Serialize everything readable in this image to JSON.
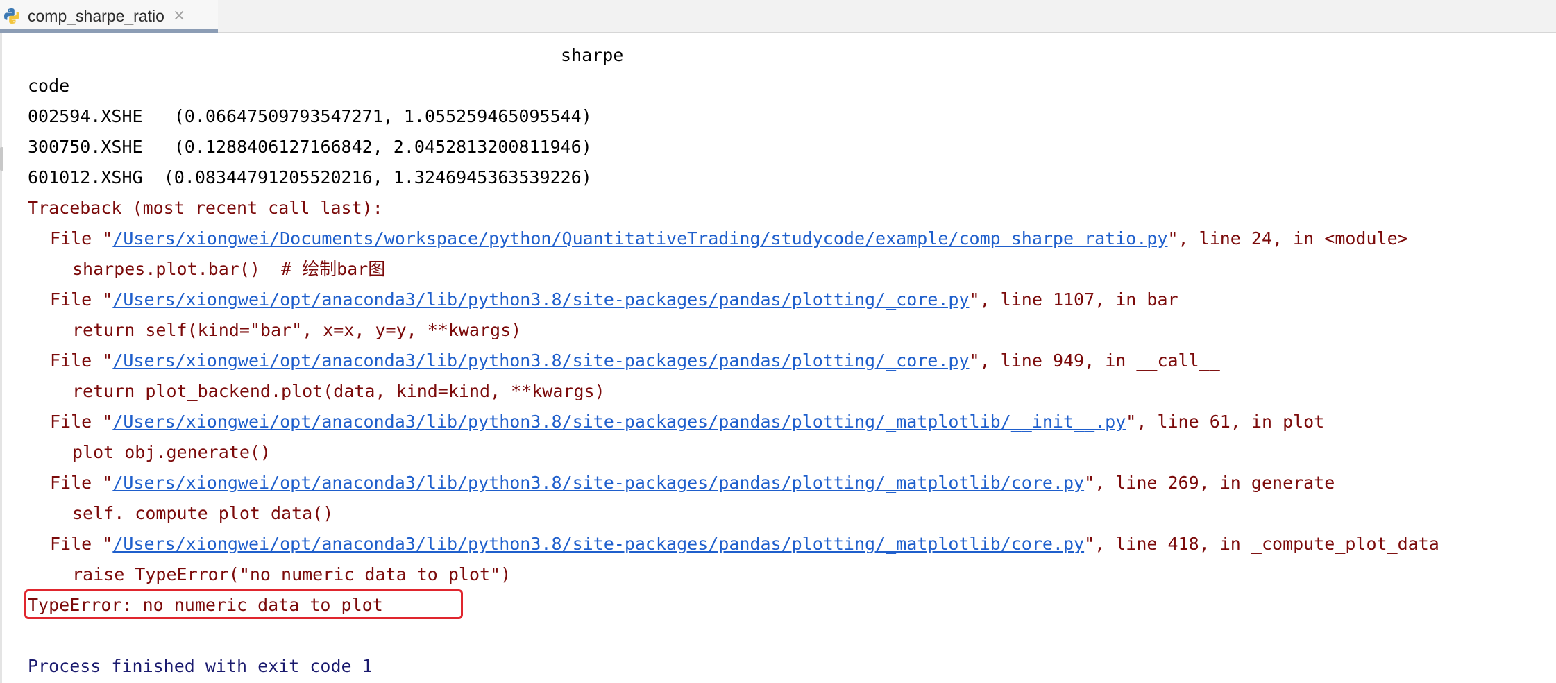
{
  "tab": {
    "title": "comp_sharpe_ratio",
    "icon": "python-icon",
    "close_glyph": "×"
  },
  "console": {
    "header": "sharpe",
    "index_name": "code",
    "rows": [
      {
        "code": "002594.XSHE",
        "value": "(0.06647509793547271, 1.055259465095544)"
      },
      {
        "code": "300750.XSHE",
        "value": "(0.1288406127166842, 2.0452813200811946)"
      },
      {
        "code": "601012.XSHG",
        "value": "(0.08344791205520216, 1.3246945363539226)"
      }
    ],
    "traceback_header": "Traceback (most recent call last):",
    "frames": [
      {
        "prefix": "File \"",
        "path": "/Users/xiongwei/Documents/workspace/python/QuantitativeTrading/studycode/example/comp_sharpe_ratio.py",
        "suffix": "\", line 24, in <module>",
        "code": "sharpes.plot.bar()  # 绘制bar图"
      },
      {
        "prefix": "File \"",
        "path": "/Users/xiongwei/opt/anaconda3/lib/python3.8/site-packages/pandas/plotting/_core.py",
        "suffix": "\", line 1107, in bar",
        "code": "return self(kind=\"bar\", x=x, y=y, **kwargs)"
      },
      {
        "prefix": "File \"",
        "path": "/Users/xiongwei/opt/anaconda3/lib/python3.8/site-packages/pandas/plotting/_core.py",
        "suffix": "\", line 949, in __call__",
        "code": "return plot_backend.plot(data, kind=kind, **kwargs)"
      },
      {
        "prefix": "File \"",
        "path": "/Users/xiongwei/opt/anaconda3/lib/python3.8/site-packages/pandas/plotting/_matplotlib/__init__.py",
        "suffix": "\", line 61, in plot",
        "code": "plot_obj.generate()"
      },
      {
        "prefix": "File \"",
        "path": "/Users/xiongwei/opt/anaconda3/lib/python3.8/site-packages/pandas/plotting/_matplotlib/core.py",
        "suffix": "\", line 269, in generate",
        "code": "self._compute_plot_data()"
      },
      {
        "prefix": "File \"",
        "path": "/Users/xiongwei/opt/anaconda3/lib/python3.8/site-packages/pandas/plotting/_matplotlib/core.py",
        "suffix": "\", line 418, in _compute_plot_data",
        "code": "raise TypeError(\"no numeric data to plot\")"
      }
    ],
    "error_message": "TypeError: no numeric data to plot",
    "blank": "",
    "exit_message": "Process finished with exit code 1"
  },
  "colors": {
    "error_text": "#7b0a0a",
    "link": "#1f5fcc",
    "highlight_box": "#e0262e",
    "exit_text": "#1a1a6e"
  }
}
